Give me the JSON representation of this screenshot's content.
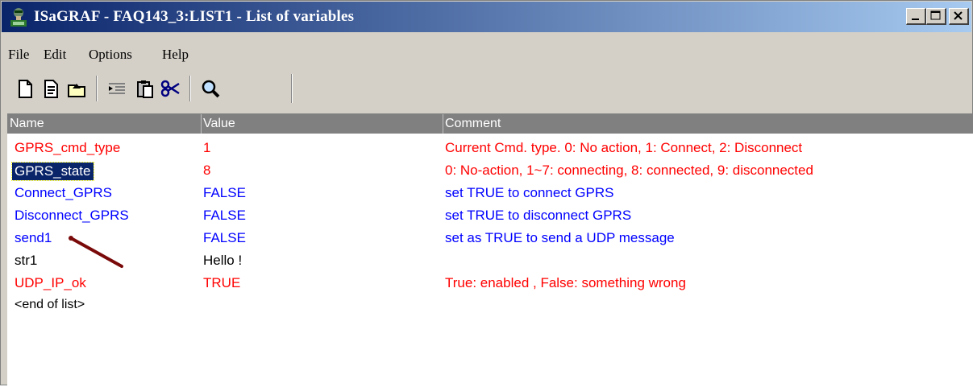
{
  "window": {
    "title": "ISaGRAF - FAQ143_3:LIST1 - List of variables",
    "app_icon": "isagraf-app-icon",
    "title_bar_colors": {
      "start": "#0a246a",
      "end": "#a6caf0"
    }
  },
  "menu": {
    "items": [
      "File",
      "Edit",
      "Options",
      "Help"
    ]
  },
  "toolbar": {
    "buttons": [
      {
        "icon": "new-document-icon"
      },
      {
        "icon": "edit-document-icon"
      },
      {
        "icon": "open-folder-icon"
      },
      {
        "icon": "indent-icon"
      },
      {
        "icon": "paste-icon"
      },
      {
        "icon": "scissors-icon"
      },
      {
        "icon": "magnifier-icon"
      }
    ]
  },
  "list": {
    "columns": [
      "Name",
      "Value",
      "Comment"
    ],
    "rows": [
      {
        "name": "GPRS_cmd_type",
        "value": "1",
        "comment": "Current Cmd. type. 0: No action, 1: Connect, 2: Disconnect",
        "color": "red"
      },
      {
        "name": "GPRS_state",
        "value": "8",
        "comment": "0: No-action, 1~7: connecting, 8: connected, 9: disconnected",
        "color": "red",
        "selected": true
      },
      {
        "name": "Connect_GPRS",
        "value": "FALSE",
        "comment": "set TRUE to connect GPRS",
        "color": "blue"
      },
      {
        "name": "Disconnect_GPRS",
        "value": "FALSE",
        "comment": "set TRUE to disconnect GPRS",
        "color": "blue"
      },
      {
        "name": "send1",
        "value": "FALSE",
        "comment": "set as TRUE to send a UDP message",
        "color": "blue"
      },
      {
        "name": "str1",
        "value": "Hello !",
        "comment": "",
        "color": "black"
      },
      {
        "name": "UDP_IP_ok",
        "value": "TRUE",
        "comment": "True: enabled , False: something wrong",
        "color": "red"
      }
    ],
    "end_marker": "<end of list>"
  },
  "colors": {
    "red": "#ff0000",
    "blue": "#0000ff",
    "black": "#000000",
    "header_bg": "#808080",
    "annotation_arrow": "#7a0a0a"
  }
}
